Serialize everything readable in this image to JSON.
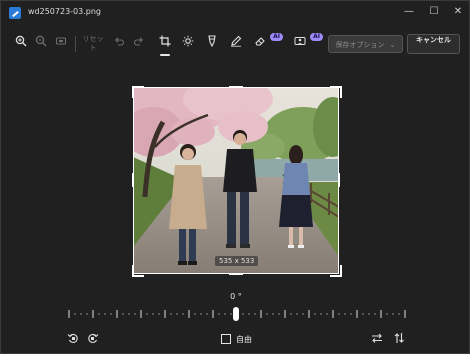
{
  "window": {
    "title": "wd250723-03.png",
    "controls": {
      "minimize": "—",
      "maximize": "☐",
      "close": "✕"
    }
  },
  "toolbar": {
    "zoom_in_icon": "zoom-in-icon",
    "zoom_out_icon": "zoom-out-icon",
    "fit_icon": "fit-to-window-icon",
    "reset_label": "リセット",
    "undo_icon": "undo-icon",
    "redo_icon": "redo-icon",
    "crop_icon": "crop-icon",
    "adjust_icon": "brightness-icon",
    "filter_icon": "filter-icon",
    "markup_icon": "pen-icon",
    "erase_icon": "eraser-icon",
    "ai_badge_1": "AI",
    "background_icon": "background-icon",
    "ai_badge_2": "AI",
    "save_label": "保存オプション",
    "save_chevron": "⌄",
    "cancel_label": "キャンセル"
  },
  "canvas": {
    "dimensions_label": "535 x 533"
  },
  "rotation": {
    "angle_label": "0 °"
  },
  "bottom_bar": {
    "rotate_left_icon": "rotate-left-icon",
    "rotate_right_icon": "rotate-right-icon",
    "aspect_label": "自由",
    "flip_horizontal_icon": "flip-horizontal-icon",
    "flip_vertical_icon": "flip-vertical-icon"
  },
  "colors": {
    "background": "#202020",
    "ai_badge": "#9d8cf7",
    "accent": "#2b7bd8"
  }
}
